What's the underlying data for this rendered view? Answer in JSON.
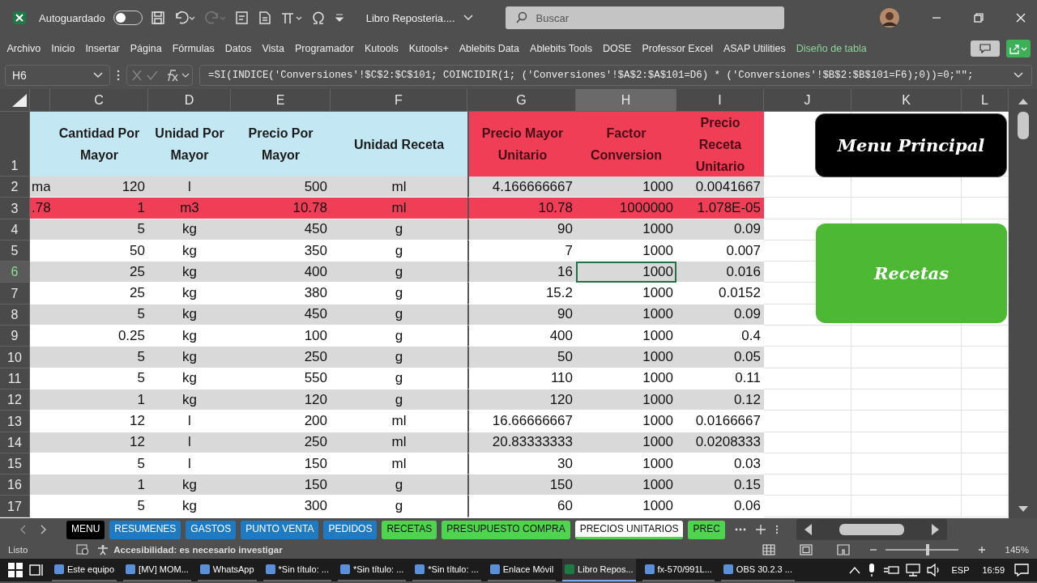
{
  "titlebar": {
    "autosave_label": "Autoguardado",
    "autosave_on": false,
    "title": "Libro Reposteria....",
    "search": {
      "placeholder": "Buscar"
    }
  },
  "ribbon_tabs": [
    {
      "label": "Archivo",
      "contextual": false
    },
    {
      "label": "Inicio",
      "contextual": false
    },
    {
      "label": "Insertar",
      "contextual": false
    },
    {
      "label": "Página",
      "contextual": false
    },
    {
      "label": "Fórmulas",
      "contextual": false
    },
    {
      "label": "Datos",
      "contextual": false
    },
    {
      "label": "Vista",
      "contextual": false
    },
    {
      "label": "Programador",
      "contextual": false
    },
    {
      "label": "Kutools",
      "contextual": false
    },
    {
      "label": "Kutools+",
      "contextual": false
    },
    {
      "label": "Ablebits Data",
      "contextual": false
    },
    {
      "label": "Ablebits Tools",
      "contextual": false
    },
    {
      "label": "DOSE",
      "contextual": false
    },
    {
      "label": "Professor Excel",
      "contextual": false
    },
    {
      "label": "ASAP Utilities",
      "contextual": false
    },
    {
      "label": "Diseño de tabla",
      "contextual": true
    }
  ],
  "formula_bar": {
    "name_box": "H6",
    "formula": "=SI(INDICE('Conversiones'!$C$2:$C$101; COINCIDIR(1; ('Conversiones'!$A$2:$A$101=D6) * ('Conversiones'!$B$2:$B$101=F6);0))=0;\"\";"
  },
  "columns": [
    {
      "label": "C",
      "selected": false
    },
    {
      "label": "D",
      "selected": false
    },
    {
      "label": "E",
      "selected": false
    },
    {
      "label": "F",
      "selected": false
    },
    {
      "label": "G",
      "selected": false
    },
    {
      "label": "H",
      "selected": true
    },
    {
      "label": "I",
      "selected": false
    },
    {
      "label": "J",
      "selected": false
    },
    {
      "label": "K",
      "selected": false
    },
    {
      "label": "L",
      "selected": false
    }
  ],
  "header_row": {
    "number": "1",
    "cells": [
      {
        "text": "Cantidad Por Mayor",
        "color": "#c3e8f4"
      },
      {
        "text": "Unidad Por Mayor",
        "color": "#c3e8f4"
      },
      {
        "text": "Precio Por Mayor",
        "color": "#c3e8f4"
      },
      {
        "text": "Unidad Receta",
        "color": "#c3e8f4"
      },
      {
        "text": "Precio Mayor Unitario",
        "color": "#ef3e55"
      },
      {
        "text": "Factor Conversion",
        "color": "#ef3e55"
      },
      {
        "text": "Precio Receta Unitario",
        "color": "#ef3e55"
      }
    ]
  },
  "rows": [
    {
      "number": "2",
      "selected": false,
      "highlighted": false,
      "column_b": "ma",
      "cells": [
        "120",
        "l",
        "500",
        "ml",
        "4.166666667",
        "1000",
        "0.0041667"
      ]
    },
    {
      "number": "3",
      "selected": false,
      "highlighted": true,
      "column_b": ".78",
      "cells": [
        "1",
        "m3",
        "10.78",
        "ml",
        "10.78",
        "1000000",
        "1.078E-05"
      ]
    },
    {
      "number": "4",
      "selected": false,
      "highlighted": false,
      "cells": [
        "5",
        "kg",
        "450",
        "g",
        "90",
        "1000",
        "0.09"
      ]
    },
    {
      "number": "5",
      "selected": false,
      "highlighted": false,
      "cells": [
        "50",
        "kg",
        "350",
        "g",
        "7",
        "1000",
        "0.007"
      ]
    },
    {
      "number": "6",
      "selected": true,
      "highlighted": false,
      "cells": [
        "25",
        "kg",
        "400",
        "g",
        "16",
        "1000",
        "0.016"
      ]
    },
    {
      "number": "7",
      "selected": false,
      "highlighted": false,
      "cells": [
        "25",
        "kg",
        "380",
        "g",
        "15.2",
        "1000",
        "0.0152"
      ]
    },
    {
      "number": "8",
      "selected": false,
      "highlighted": false,
      "cells": [
        "5",
        "kg",
        "450",
        "g",
        "90",
        "1000",
        "0.09"
      ]
    },
    {
      "number": "9",
      "selected": false,
      "highlighted": false,
      "cells": [
        "0.25",
        "kg",
        "100",
        "g",
        "400",
        "1000",
        "0.4"
      ]
    },
    {
      "number": "10",
      "selected": false,
      "highlighted": false,
      "cells": [
        "5",
        "kg",
        "250",
        "g",
        "50",
        "1000",
        "0.05"
      ]
    },
    {
      "number": "11",
      "selected": false,
      "highlighted": false,
      "cells": [
        "5",
        "kg",
        "550",
        "g",
        "110",
        "1000",
        "0.11"
      ]
    },
    {
      "number": "12",
      "selected": false,
      "highlighted": false,
      "cells": [
        "1",
        "kg",
        "120",
        "g",
        "120",
        "1000",
        "0.12"
      ]
    },
    {
      "number": "13",
      "selected": false,
      "highlighted": false,
      "cells": [
        "12",
        "l",
        "200",
        "ml",
        "16.66666667",
        "1000",
        "0.0166667"
      ]
    },
    {
      "number": "14",
      "selected": false,
      "highlighted": false,
      "cells": [
        "12",
        "l",
        "250",
        "ml",
        "20.83333333",
        "1000",
        "0.0208333"
      ]
    },
    {
      "number": "15",
      "selected": false,
      "highlighted": false,
      "cells": [
        "5",
        "l",
        "150",
        "ml",
        "30",
        "1000",
        "0.03"
      ]
    },
    {
      "number": "16",
      "selected": false,
      "highlighted": false,
      "cells": [
        "1",
        "kg",
        "150",
        "g",
        "150",
        "1000",
        "0.15"
      ]
    },
    {
      "number": "17",
      "selected": false,
      "highlighted": false,
      "cells": [
        "5",
        "kg",
        "300",
        "g",
        "60",
        "1000",
        "0.06"
      ]
    }
  ],
  "shape_buttons": [
    {
      "label": "Menu Principal",
      "color": "#000000"
    },
    {
      "label": "Recetas",
      "color": "#4cb833"
    }
  ],
  "sheet_tabs": [
    {
      "label": "MENU",
      "color": "#000000",
      "selected": false
    },
    {
      "label": "RESUMENES",
      "color": "#1f7ac4",
      "selected": false
    },
    {
      "label": "GASTOS",
      "color": "#1f7ac4",
      "selected": false
    },
    {
      "label": "PUNTO VENTA",
      "color": "#1f7ac4",
      "selected": false
    },
    {
      "label": "PEDIDOS",
      "color": "#1f7ac4",
      "selected": false
    },
    {
      "label": "RECETAS",
      "color": "#4fd44f",
      "selected": false
    },
    {
      "label": "PRESUPUESTO COMPRA",
      "color": "#4fd44f",
      "selected": false
    },
    {
      "label": "PRECIOS UNITARIOS",
      "color": "#4fd44f",
      "selected": true
    },
    {
      "label": "PREC",
      "color": "#4fd44f",
      "selected": false
    }
  ],
  "status_bar": {
    "ready": "Listo",
    "accessibility": "Accesibilidad: es necesario investigar",
    "zoom_slider": {
      "level": 0.58
    },
    "zoom": "145%"
  },
  "taskbar": {
    "items": [
      {
        "label": "Este equipo",
        "selected": false
      },
      {
        "label": "[MV] MOM...",
        "selected": false
      },
      {
        "label": "WhatsApp",
        "selected": false
      },
      {
        "label": "*Sin título: ...",
        "selected": false
      },
      {
        "label": "*Sin título: ...",
        "selected": false
      },
      {
        "label": "*Sin título: ...",
        "selected": false
      },
      {
        "label": "Enlace Móvil",
        "selected": false
      },
      {
        "label": "Libro Repos...",
        "selected": true
      },
      {
        "label": "fx-570/991L...",
        "selected": false
      },
      {
        "label": "OBS 30.2.3 ...",
        "selected": false
      }
    ],
    "language": "ESP",
    "time": "16:59"
  }
}
